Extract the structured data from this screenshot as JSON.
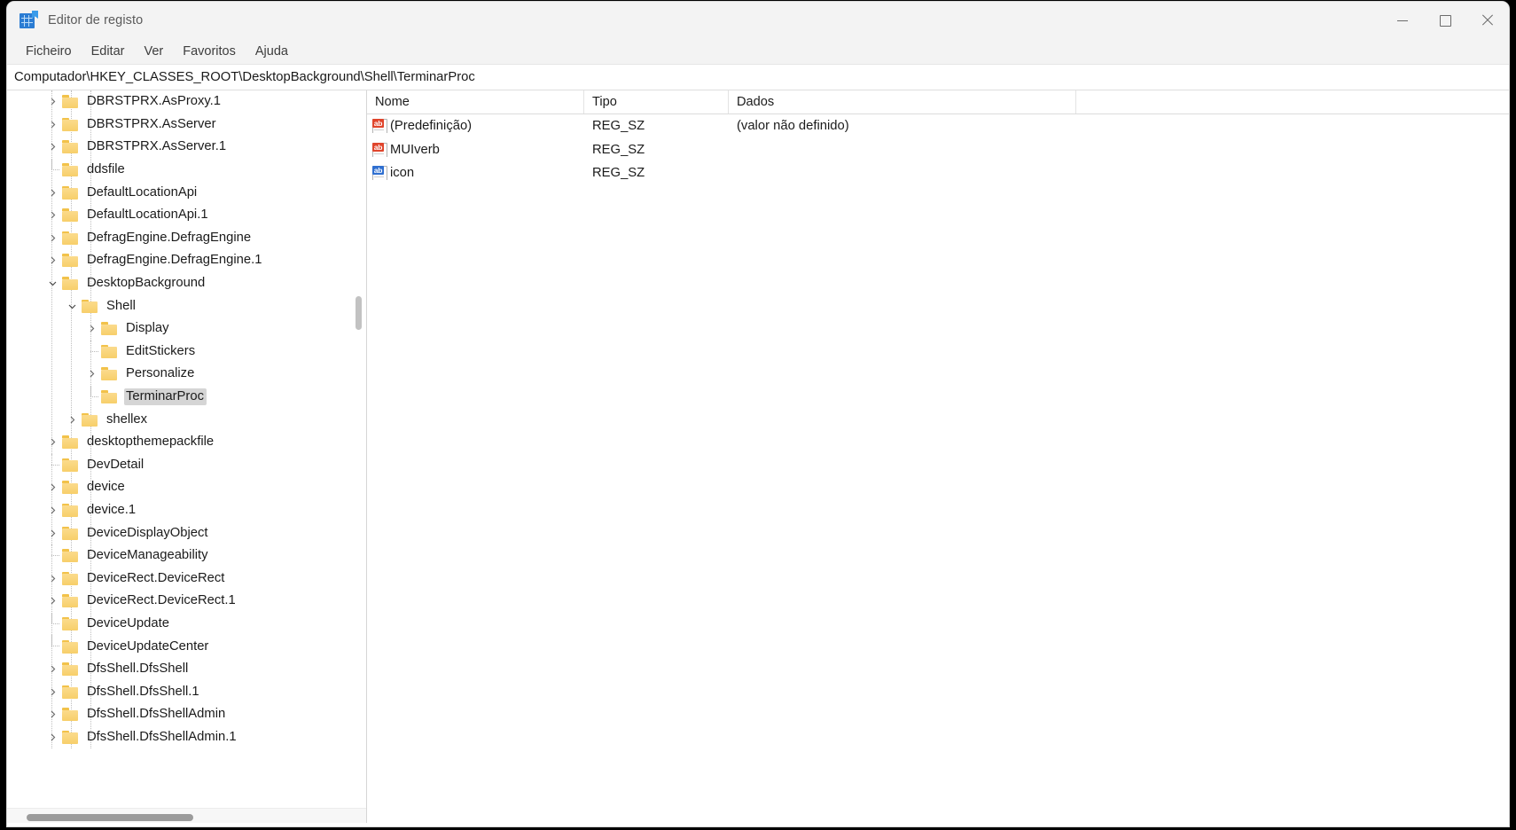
{
  "window": {
    "title": "Editor de registo",
    "app_icon": "registry-editor-icon",
    "controls": {
      "minimize": "minimize-icon",
      "maximize": "maximize-icon",
      "close": "close-icon"
    }
  },
  "menu": {
    "items": [
      {
        "label": "Ficheiro"
      },
      {
        "label": "Editar"
      },
      {
        "label": "Ver"
      },
      {
        "label": "Favoritos"
      },
      {
        "label": "Ajuda"
      }
    ]
  },
  "address": {
    "path": "Computador\\HKEY_CLASSES_ROOT\\DesktopBackground\\Shell\\TerminarProc"
  },
  "tree": {
    "items": [
      {
        "label": "DBRSTPRX.AsProxy.1",
        "depth": 1,
        "twisty": "collapsed",
        "selected": false
      },
      {
        "label": "DBRSTPRX.AsServer",
        "depth": 1,
        "twisty": "collapsed",
        "selected": false
      },
      {
        "label": "DBRSTPRX.AsServer.1",
        "depth": 1,
        "twisty": "collapsed",
        "selected": false
      },
      {
        "label": "ddsfile",
        "depth": 1,
        "twisty": "leaf",
        "selected": false
      },
      {
        "label": "DefaultLocationApi",
        "depth": 1,
        "twisty": "collapsed",
        "selected": false
      },
      {
        "label": "DefaultLocationApi.1",
        "depth": 1,
        "twisty": "collapsed",
        "selected": false
      },
      {
        "label": "DefragEngine.DefragEngine",
        "depth": 1,
        "twisty": "collapsed",
        "selected": false
      },
      {
        "label": "DefragEngine.DefragEngine.1",
        "depth": 1,
        "twisty": "collapsed",
        "selected": false
      },
      {
        "label": "DesktopBackground",
        "depth": 1,
        "twisty": "expanded",
        "selected": false
      },
      {
        "label": "Shell",
        "depth": 2,
        "twisty": "expanded",
        "selected": false
      },
      {
        "label": "Display",
        "depth": 3,
        "twisty": "collapsed",
        "selected": false
      },
      {
        "label": "EditStickers",
        "depth": 3,
        "twisty": "leaf",
        "selected": false
      },
      {
        "label": "Personalize",
        "depth": 3,
        "twisty": "collapsed",
        "selected": false
      },
      {
        "label": "TerminarProc",
        "depth": 3,
        "twisty": "leaf",
        "selected": true
      },
      {
        "label": "shellex",
        "depth": 2,
        "twisty": "collapsed",
        "selected": false
      },
      {
        "label": "desktopthemepackfile",
        "depth": 1,
        "twisty": "collapsed",
        "selected": false
      },
      {
        "label": "DevDetail",
        "depth": 1,
        "twisty": "leaf",
        "selected": false
      },
      {
        "label": "device",
        "depth": 1,
        "twisty": "collapsed",
        "selected": false
      },
      {
        "label": "device.1",
        "depth": 1,
        "twisty": "collapsed",
        "selected": false
      },
      {
        "label": "DeviceDisplayObject",
        "depth": 1,
        "twisty": "collapsed",
        "selected": false
      },
      {
        "label": "DeviceManageability",
        "depth": 1,
        "twisty": "leaf",
        "selected": false
      },
      {
        "label": "DeviceRect.DeviceRect",
        "depth": 1,
        "twisty": "collapsed",
        "selected": false
      },
      {
        "label": "DeviceRect.DeviceRect.1",
        "depth": 1,
        "twisty": "collapsed",
        "selected": false
      },
      {
        "label": "DeviceUpdate",
        "depth": 1,
        "twisty": "leaf",
        "selected": false
      },
      {
        "label": "DeviceUpdateCenter",
        "depth": 1,
        "twisty": "leaf",
        "selected": false
      },
      {
        "label": "DfsShell.DfsShell",
        "depth": 1,
        "twisty": "collapsed",
        "selected": false
      },
      {
        "label": "DfsShell.DfsShell.1",
        "depth": 1,
        "twisty": "collapsed",
        "selected": false
      },
      {
        "label": "DfsShell.DfsShellAdmin",
        "depth": 1,
        "twisty": "collapsed",
        "selected": false
      },
      {
        "label": "DfsShell.DfsShellAdmin.1",
        "depth": 1,
        "twisty": "collapsed",
        "selected": false
      }
    ]
  },
  "values": {
    "columns": [
      {
        "label": "Nome"
      },
      {
        "label": "Tipo"
      },
      {
        "label": "Dados"
      }
    ],
    "rows": [
      {
        "name": "(Predefinição)",
        "type": "REG_SZ",
        "data": "(valor não definido)",
        "icon": "string-value-icon",
        "icon_color": "red"
      },
      {
        "name": "MUIverb",
        "type": "REG_SZ",
        "data": "",
        "icon": "string-value-icon",
        "icon_color": "red"
      },
      {
        "name": "icon",
        "type": "REG_SZ",
        "data": "",
        "icon": "string-value-icon",
        "icon_color": "blue"
      }
    ]
  },
  "colors": {
    "accent": "#2b7cd3",
    "folder": "#f7cf6a",
    "selection": "#d5d5d5",
    "string_icon_red": "#e0452c",
    "string_icon_blue": "#2f6fd0"
  }
}
